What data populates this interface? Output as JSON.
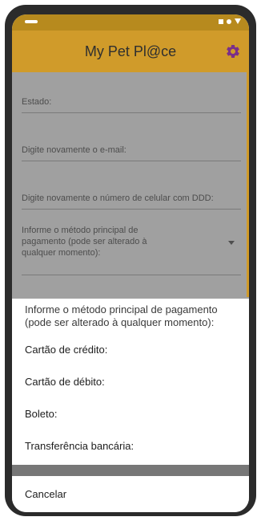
{
  "app": {
    "title": "My Pet Pl@ce",
    "settings_icon": "gear-icon"
  },
  "colors": {
    "appbar": "#d09b2a",
    "statusbar": "#b78a1e"
  },
  "form": {
    "estado": "Estado:",
    "email_confirm": "Digite novamente o e-mail:",
    "phone_confirm": "Digite novamente o número de celular com DDD:",
    "payment_label": "Informe o método principal de pagamento (pode ser alterado à qualquer momento):"
  },
  "sheet": {
    "title": "Informe o método principal de pagamento (pode ser alterado à qualquer momento):",
    "options": [
      "Cartão de crédito:",
      "Cartão de débito:",
      "Boleto:",
      "Transferência bancária:"
    ],
    "cancel": "Cancelar"
  }
}
